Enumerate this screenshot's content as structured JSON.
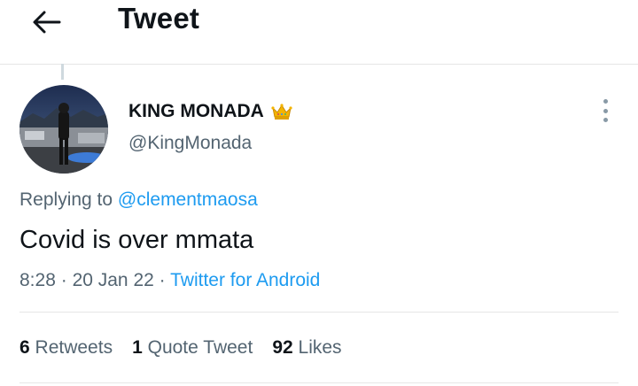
{
  "header": {
    "title": "Tweet",
    "back_icon": "arrow-left-icon"
  },
  "tweet": {
    "author_name": "KING MONADA",
    "badge_icon": "crown-icon",
    "author_handle": "@KingMonada",
    "replying_prefix": "Replying to",
    "replying_to": "@clementmaosa",
    "text": "Covid is over mmata",
    "time": "8:28",
    "date": "20 Jan 22",
    "separator": "·",
    "source": "Twitter for Android",
    "more_icon": "more-vertical-icon"
  },
  "stats": {
    "retweets_count": "6",
    "retweets_label": "Retweets",
    "quotes_count": "1",
    "quotes_label": "Quote Tweet",
    "likes_count": "92",
    "likes_label": "Likes"
  },
  "colors": {
    "accent": "#1d9bf0",
    "secondary_text": "#536471",
    "primary_text": "#0f1419"
  }
}
